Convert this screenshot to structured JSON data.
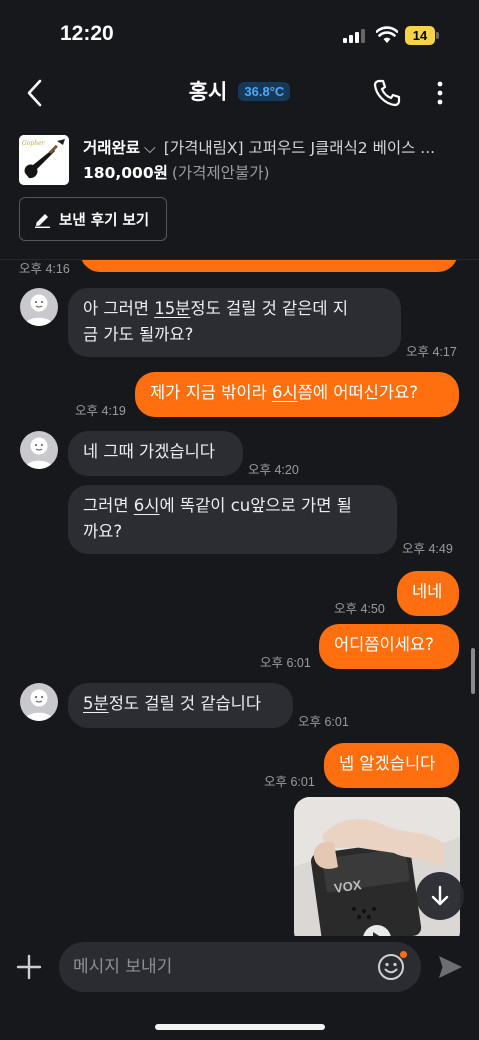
{
  "status_bar": {
    "time": "12:20",
    "battery": "14"
  },
  "header": {
    "title": "홍시",
    "temperature": "36.8°C"
  },
  "product": {
    "status": "거래완료",
    "title": "[가격내림X] 고퍼우드 J클래식2 베이스 ...",
    "price": "180,000원",
    "price_note": "(가격제안불가)",
    "review_button": "보낸 후기 보기"
  },
  "messages": [
    {
      "side": "out",
      "text": "",
      "time": "오후 4:16"
    },
    {
      "side": "in",
      "line1_pre": "아 그러면 ",
      "line1_u": "15분",
      "line1_post": "정도 걸릴 것 같은데 지",
      "line2": "금 가도 될까요?",
      "time": "오후 4:17"
    },
    {
      "side": "out",
      "pre": "제가 지금 밖이라 ",
      "u": "6시",
      "post": "쯤에 어떠신가요?",
      "time": "오후 4:19"
    },
    {
      "side": "in",
      "text": "네 그때 가겠습니다",
      "time": "오후 4:20"
    },
    {
      "side": "in",
      "line1_pre": "그러면 ",
      "line1_u": "6시",
      "line1_post": "에 똑같이 cu앞으로 가면 될",
      "line2": "까요?",
      "time": "오후 4:49"
    },
    {
      "side": "out",
      "text": "네네",
      "time": "오후 4:50"
    },
    {
      "side": "out",
      "text": "어디쯤이세요?",
      "time": "오후 6:01"
    },
    {
      "side": "in",
      "u": "5분",
      "post": "정도 걸릴 것 같습니다",
      "time": "오후 6:01"
    },
    {
      "side": "out",
      "text": "넵 알겠습니다",
      "time": "오후 6:01"
    }
  ],
  "media_text": "VOX",
  "composer": {
    "placeholder": "메시지 보내기"
  },
  "colors": {
    "accent": "#ff6f0f",
    "background": "#17181c",
    "incoming_bubble": "#2c2d32",
    "temperature": "#4ea7f7"
  },
  "icons": [
    "back-icon",
    "phone-icon",
    "more-icon",
    "pencil-icon",
    "avatar-icon",
    "arrow-down-icon",
    "plus-icon",
    "emoji-icon",
    "send-icon"
  ]
}
